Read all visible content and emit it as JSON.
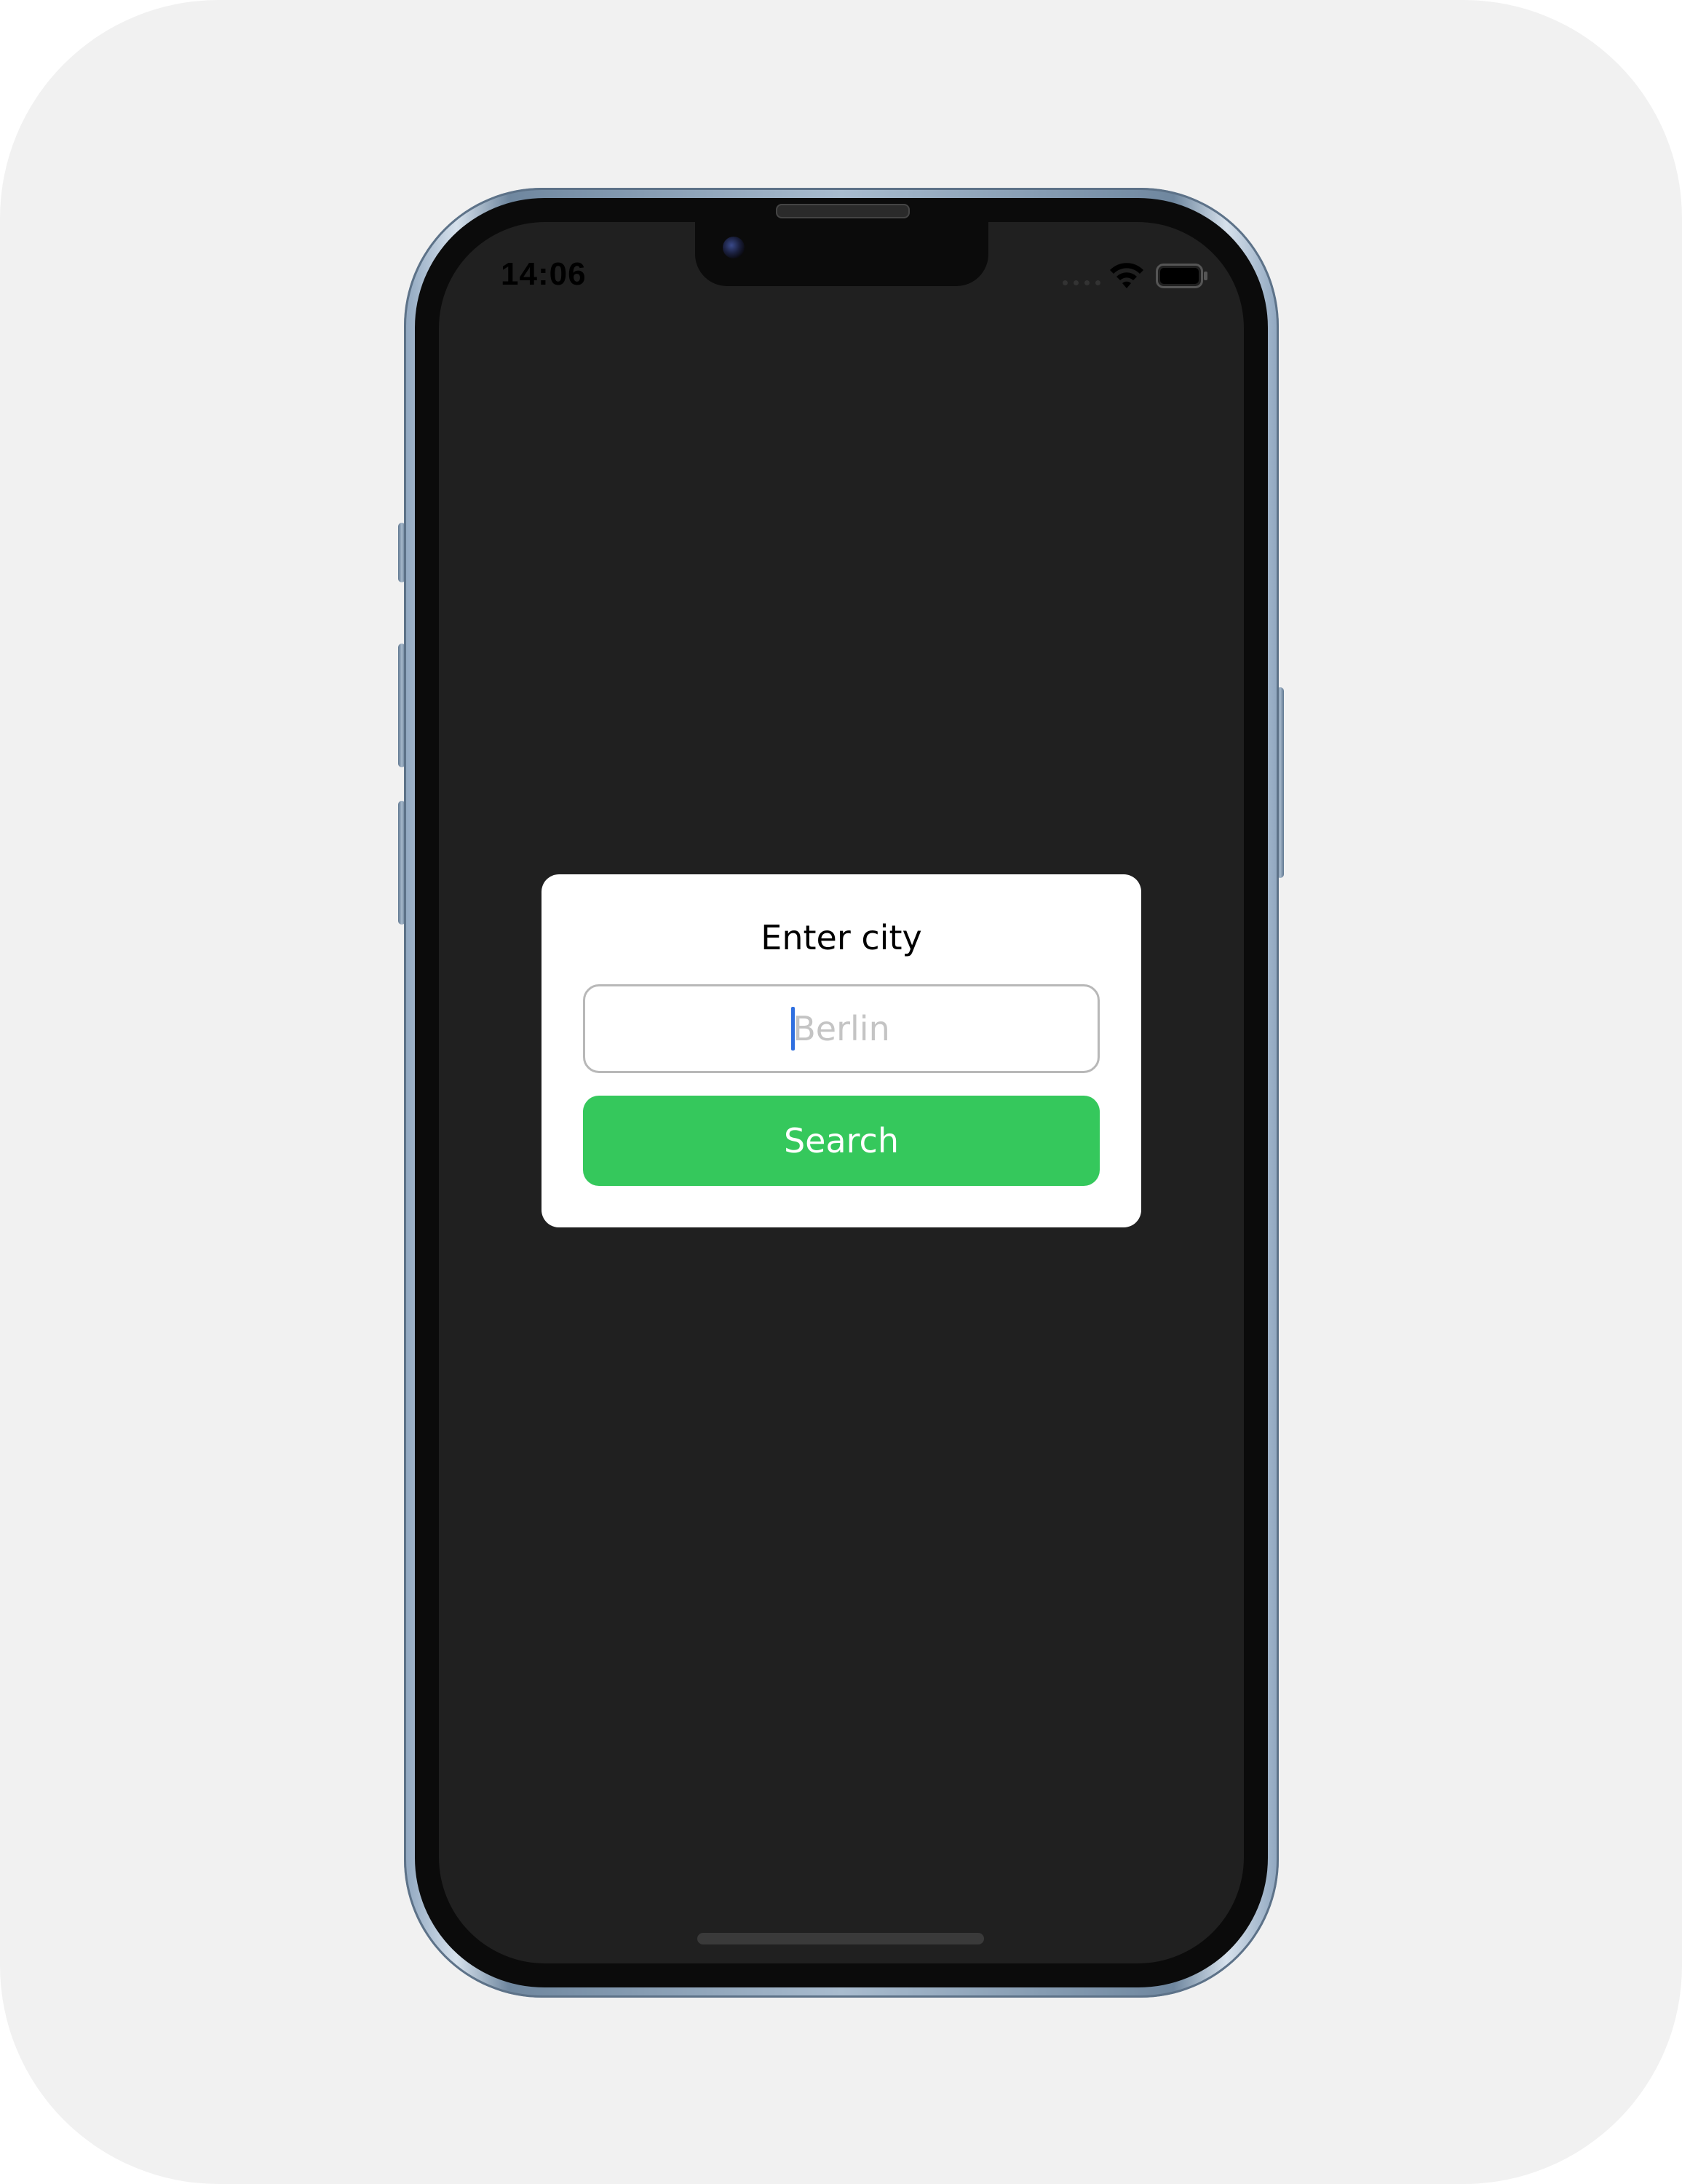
{
  "status_bar": {
    "time": "14:06",
    "wifi_icon": "wifi-icon",
    "battery_icon": "battery-icon"
  },
  "dialog": {
    "title": "Enter city",
    "input": {
      "value": "",
      "placeholder": "Berlin"
    },
    "search_label": "Search"
  },
  "colors": {
    "screen_background": "#202020",
    "dialog_background": "#ffffff",
    "button_green": "#35c85c",
    "caret_blue": "#2f6fe0",
    "placeholder_gray": "#c4c4c4"
  }
}
